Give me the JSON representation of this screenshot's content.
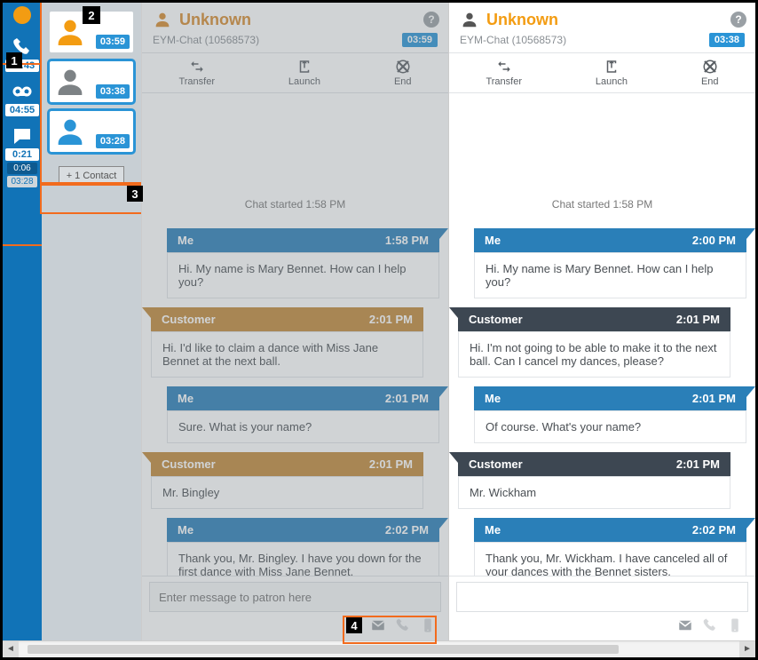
{
  "annotations": {
    "a1": "1",
    "a2": "2",
    "a3": "3",
    "a4": "4"
  },
  "rail": {
    "items": [
      {
        "icon": "phone",
        "timer": "02:43"
      },
      {
        "icon": "voicemail",
        "timer": "04:55"
      },
      {
        "icon": "chat",
        "timer": "0:21",
        "sub1": "0:06",
        "sub2": "03:28"
      }
    ]
  },
  "contacts": {
    "items": [
      {
        "color": "#f39c12",
        "time": "03:59",
        "selected": false
      },
      {
        "color": "#7d8285",
        "time": "03:38",
        "selected": true
      },
      {
        "color": "#2a94d6",
        "time": "03:28",
        "selected": true
      }
    ],
    "add_label": "+ 1 Contact"
  },
  "chats": [
    {
      "side": "left",
      "title": "Unknown",
      "sub": "EYM-Chat (10568573)",
      "badge": "03:59",
      "start": "Chat started 1:58 PM",
      "tools": {
        "transfer": "Transfer",
        "launch": "Launch",
        "end": "End"
      },
      "placeholder": "Enter message to patron here",
      "messages": [
        {
          "who": "me",
          "name": "Me",
          "time": "1:58 PM",
          "text": "Hi. My name is Mary Bennet. How can I help you?"
        },
        {
          "who": "cust",
          "name": "Customer",
          "time": "2:01 PM",
          "text": "Hi. I'd like to claim a dance with Miss Jane Bennet at the next ball."
        },
        {
          "who": "me",
          "name": "Me",
          "time": "2:01 PM",
          "text": "Sure. What is your name?"
        },
        {
          "who": "cust",
          "name": "Customer",
          "time": "2:01 PM",
          "text": "Mr. Bingley"
        },
        {
          "who": "me",
          "name": "Me",
          "time": "2:02 PM",
          "text": "Thank you, Mr. Bingley. I have you down for the first dance with Miss Jane Bennet."
        }
      ]
    },
    {
      "side": "right",
      "title": "Unknown",
      "sub": "EYM-Chat (10568573)",
      "badge": "03:38",
      "start": "Chat started 1:58 PM",
      "tools": {
        "transfer": "Transfer",
        "launch": "Launch",
        "end": "End"
      },
      "placeholder": "",
      "messages": [
        {
          "who": "me",
          "name": "Me",
          "time": "2:00 PM",
          "text": "Hi. My name is Mary Bennet. How can I help you?"
        },
        {
          "who": "cust",
          "name": "Customer",
          "time": "2:01 PM",
          "text": "Hi. I'm not going to be able to make it to the next ball. Can I cancel my dances, please?"
        },
        {
          "who": "me",
          "name": "Me",
          "time": "2:01 PM",
          "text": "Of course. What's your name?"
        },
        {
          "who": "cust",
          "name": "Customer",
          "time": "2:01 PM",
          "text": "Mr. Wickham"
        },
        {
          "who": "me",
          "name": "Me",
          "time": "2:02 PM",
          "text": "Thank you, Mr. Wickham. I have canceled all of your dances with the Bennet sisters."
        }
      ]
    }
  ]
}
